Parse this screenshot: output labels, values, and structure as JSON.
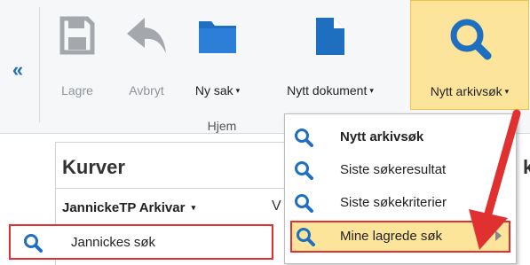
{
  "ribbon": {
    "collapse_label": "«",
    "buttons": [
      {
        "label": "Lagre",
        "icon": "save-icon",
        "enabled": false
      },
      {
        "label": "Avbryt",
        "icon": "undo-arrow-icon",
        "enabled": false
      },
      {
        "label": "Ny sak",
        "icon": "folder-icon",
        "enabled": true,
        "dropdown": true
      },
      {
        "label": "Nytt dokument",
        "icon": "document-icon",
        "enabled": true,
        "dropdown": true
      },
      {
        "label": "Nytt arkivsøk",
        "icon": "search-icon",
        "enabled": true,
        "dropdown": true,
        "active": true
      }
    ],
    "group_label": "Hjem",
    "caret": "▾"
  },
  "panel": {
    "title": "Kurver",
    "selector": "JannickeTP Arkivar",
    "selector_caret": "▾",
    "cut_letter": "V",
    "saved_search": "Jannickes søk",
    "right_cut": "k"
  },
  "menu": {
    "items": [
      {
        "label": "Nytt arkivsøk",
        "icon": "search-icon",
        "bold": true
      },
      {
        "label": "Siste søkeresultat",
        "icon": "search-icon"
      },
      {
        "label": "Siste søkekriterier",
        "icon": "search-icon"
      },
      {
        "label": "Mine lagrede søk",
        "icon": "search-icon",
        "submenu": true,
        "highlighted": true
      }
    ]
  },
  "colors": {
    "accent_blue": "#1f6fc0",
    "highlight_yellow": "#fce49a",
    "annotation_red": "#e03030"
  }
}
